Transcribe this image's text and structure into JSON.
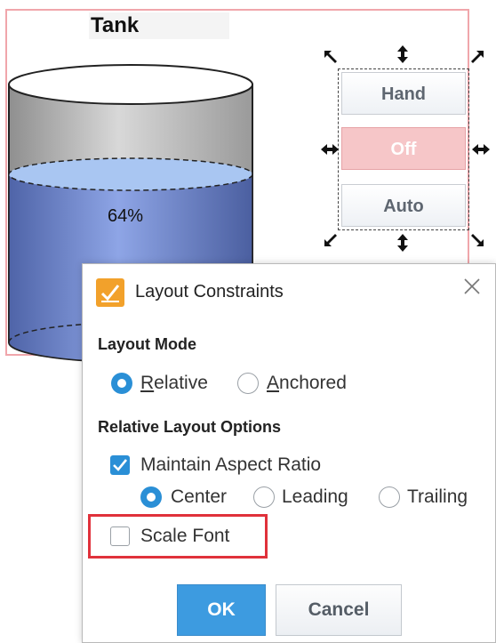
{
  "tank": {
    "title": "Tank",
    "level_label": "64%",
    "level_value": 64,
    "colors": {
      "frame": "#f0a6ab",
      "liquid": "#6f86c9",
      "liquid_top": "#a9c6f2",
      "shell": "#bdbdbd"
    }
  },
  "hoa": {
    "hand_label": "Hand",
    "off_label": "Off",
    "auto_label": "Auto",
    "active": "Off",
    "colors": {
      "off_bg": "#f6c6c8",
      "normal_bg": "#eef1f5"
    }
  },
  "dialog": {
    "title": "Layout Constraints",
    "icon": "layout-constraints-icon",
    "close_icon": "close-icon",
    "layout_mode": {
      "heading": "Layout Mode",
      "options": [
        {
          "label_first": "R",
          "label_rest": "elative",
          "selected": true
        },
        {
          "label_first": "A",
          "label_rest": "nchored",
          "selected": false
        }
      ]
    },
    "relative_options": {
      "heading": "Relative Layout Options",
      "maintain_aspect": {
        "label": "Maintain Aspect Ratio",
        "checked": true
      },
      "alignment": [
        {
          "label": "Center",
          "selected": true
        },
        {
          "label": "Leading",
          "selected": false
        },
        {
          "label": "Trailing",
          "selected": false
        }
      ],
      "scale_font": {
        "label": "Scale Font",
        "checked": false
      }
    },
    "ok_label": "OK",
    "cancel_label": "Cancel",
    "accent": "#2a8fd6",
    "highlight_color": "#e0313b"
  }
}
